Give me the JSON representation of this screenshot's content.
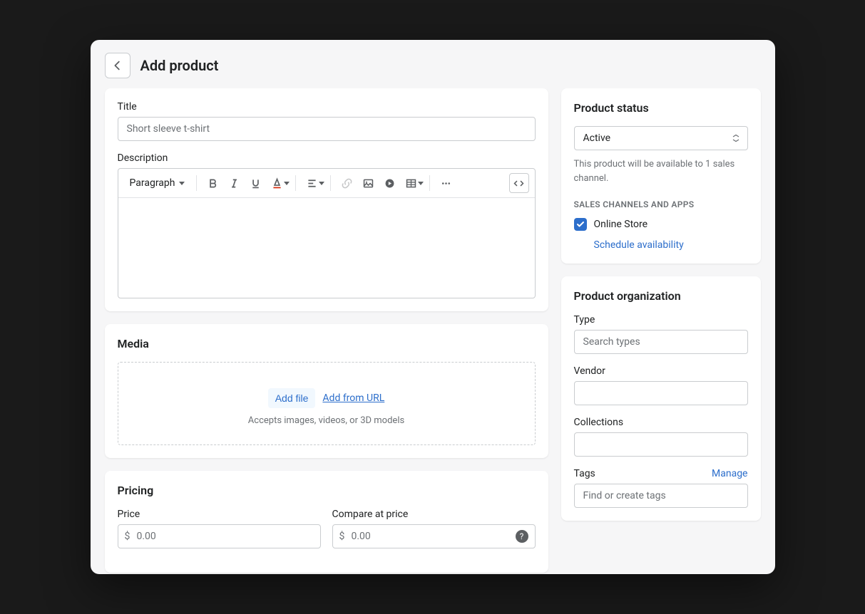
{
  "page": {
    "title": "Add product"
  },
  "title_field": {
    "label": "Title",
    "placeholder": "Short sleeve t-shirt"
  },
  "description": {
    "label": "Description",
    "format_label": "Paragraph"
  },
  "media": {
    "heading": "Media",
    "add_file": "Add file",
    "add_url": "Add from URL",
    "help": "Accepts images, videos, or 3D models"
  },
  "pricing": {
    "heading": "Pricing",
    "price_label": "Price",
    "compare_label": "Compare at price",
    "currency": "$",
    "price_placeholder": "0.00",
    "compare_placeholder": "0.00"
  },
  "status": {
    "heading": "Product status",
    "selected": "Active",
    "help": "This product will be available to 1 sales channel.",
    "channels_heading": "SALES CHANNELS AND APPS",
    "channel_name": "Online Store",
    "schedule_link": "Schedule availability"
  },
  "organization": {
    "heading": "Product organization",
    "type_label": "Type",
    "type_placeholder": "Search types",
    "vendor_label": "Vendor",
    "collections_label": "Collections",
    "tags_label": "Tags",
    "tags_placeholder": "Find or create tags",
    "manage": "Manage"
  }
}
